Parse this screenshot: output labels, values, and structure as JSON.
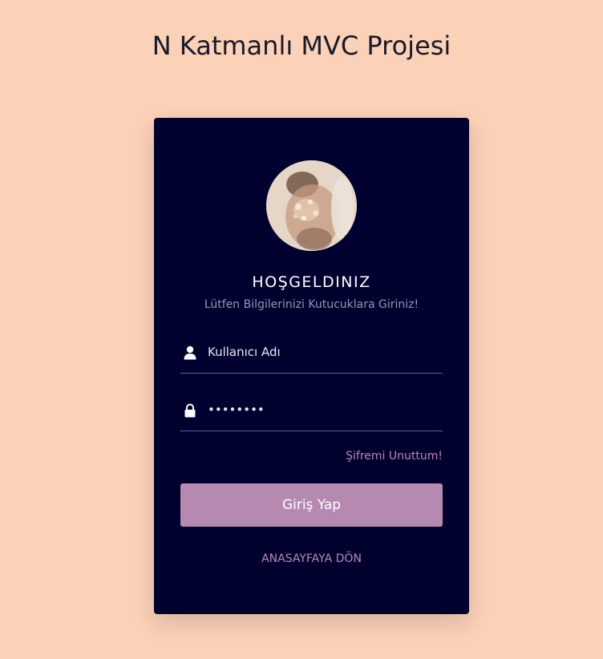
{
  "page": {
    "title": "N Katmanlı MVC Projesi"
  },
  "login_card": {
    "avatar_icon": "profile-photo",
    "welcome": "HOŞGELDINIZ",
    "subtitle": "Lütfen Bilgilerinizi Kutucuklara Giriniz!",
    "username": {
      "icon": "user-icon",
      "placeholder": "Kullanıcı Adı",
      "value": ""
    },
    "password": {
      "icon": "lock-icon",
      "placeholder": "",
      "value": "********"
    },
    "forgot_link": "Şifremi Unuttum!",
    "login_button": "Giriş Yap",
    "home_link": "ANASAYFAYA DÖN"
  },
  "colors": {
    "background": "#fbd1b7",
    "card": "#01012f",
    "accent": "#b689b1",
    "text_light": "#ffffff",
    "text_muted": "#9a96ad"
  }
}
